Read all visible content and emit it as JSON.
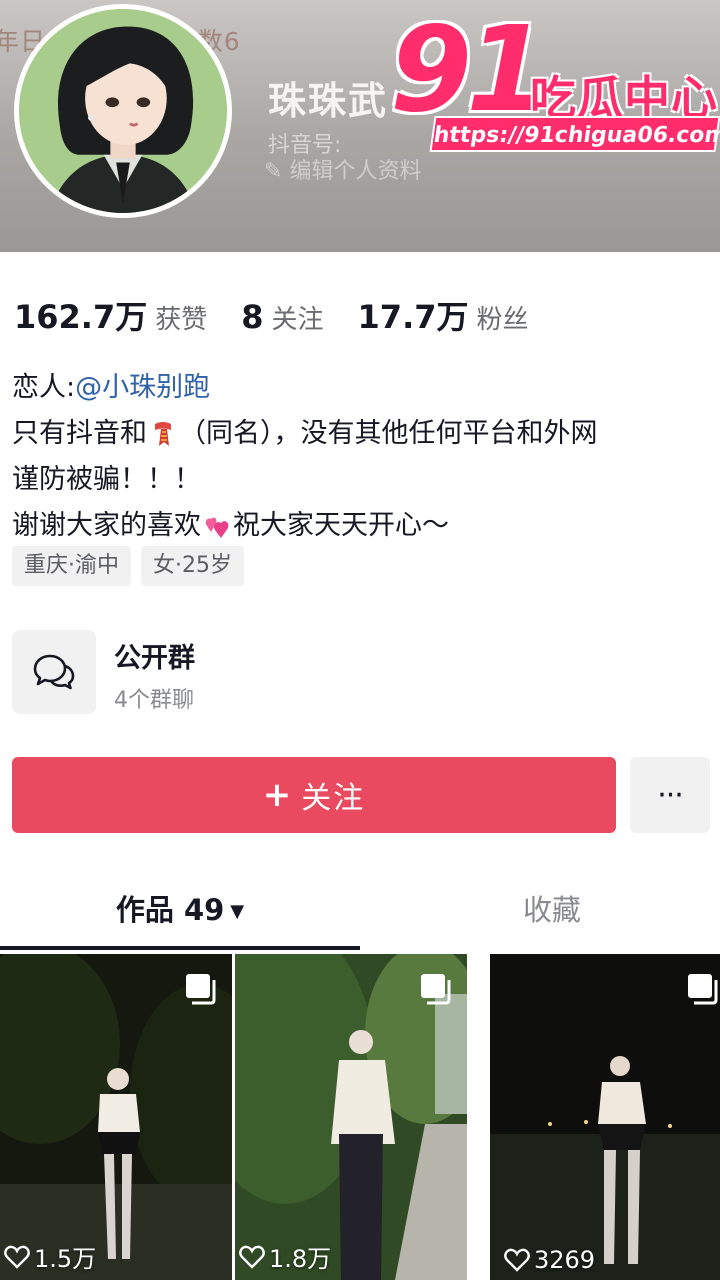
{
  "header": {
    "faded_stats": "年日  1万+，互动数6",
    "nickname": "珠珠武",
    "douyin_id_label": "抖音号:",
    "edit_profile": "编辑个人资料"
  },
  "watermark": {
    "number": "91",
    "text": "吃瓜中心",
    "url": "https://91chigua06.com"
  },
  "stats": {
    "likes_value": "162.7万",
    "likes_label": "获赞",
    "following_value": "8",
    "following_label": "关注",
    "followers_value": "17.7万",
    "followers_label": "粉丝"
  },
  "bio": {
    "lover_label": "恋人:",
    "lover_mention": "@小珠别跑",
    "line2_a": "只有抖音和",
    "line2_b": "（同名），没有其他任何平台和外网",
    "line3": "谨防被骗！！！",
    "line4_a": "谢谢大家的喜欢",
    "line4_b": "祝大家天天开心～"
  },
  "tags": {
    "location": "重庆·渝中",
    "gender_age": "女·25岁"
  },
  "group": {
    "title": "公开群",
    "subtitle": "4个群聊"
  },
  "actions": {
    "follow_plus": "+",
    "follow_label": "关注",
    "more_label": "···"
  },
  "tabs": {
    "works_label": "作品 49",
    "works_caret": "▼",
    "favorites_label": "收藏"
  },
  "videos": [
    {
      "likes": "1.5万"
    },
    {
      "likes": "1.8万"
    },
    {
      "likes": "3269"
    }
  ],
  "colors": {
    "accent": "#ea4a5f",
    "mention": "#2f62a8",
    "watermark": "#ff2d6b"
  }
}
